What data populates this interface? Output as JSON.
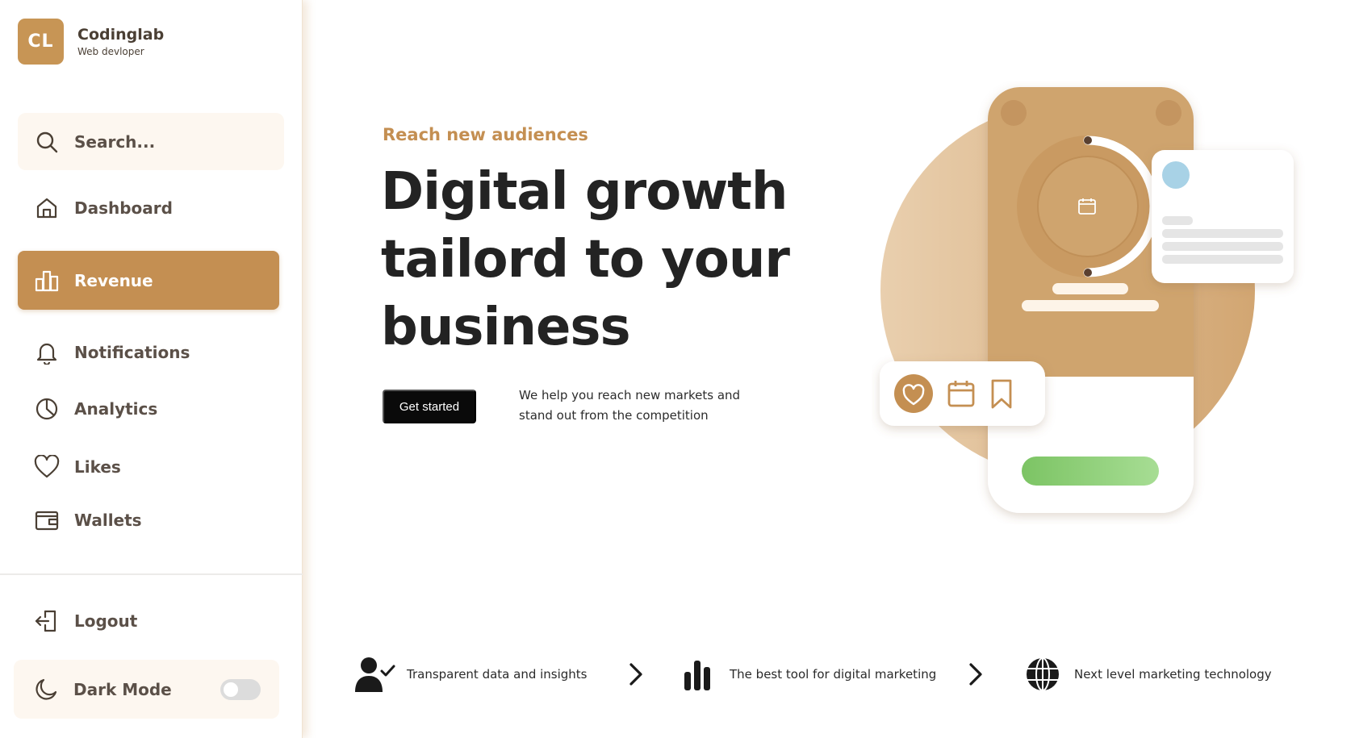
{
  "brand": {
    "initials": "CL",
    "name": "Codinglab",
    "role": "Web devloper"
  },
  "sidebar": {
    "search_label": "Search...",
    "items": [
      {
        "label": "Dashboard",
        "icon": "home-icon"
      },
      {
        "label": "Revenue",
        "icon": "bar-chart-icon",
        "active": true
      },
      {
        "label": "Notifications",
        "icon": "bell-icon"
      },
      {
        "label": "Analytics",
        "icon": "pie-chart-icon"
      },
      {
        "label": "Likes",
        "icon": "heart-icon"
      },
      {
        "label": "Wallets",
        "icon": "wallet-icon"
      }
    ],
    "logout_label": "Logout",
    "dark_mode_label": "Dark Mode",
    "dark_mode_on": false
  },
  "hero": {
    "eyebrow": "Reach new audiences",
    "headline": "Digital growth tailord to your business",
    "cta_label": "Get started",
    "tagline": "We help you reach new markets and stand out from the competition"
  },
  "features": [
    {
      "text": "Transparent data and insights",
      "icon": "user-check-icon"
    },
    {
      "text": "The best tool for digital marketing",
      "icon": "bar-chart-icon"
    },
    {
      "text": "Next level marketing technology",
      "icon": "globe-icon"
    }
  ],
  "colors": {
    "accent": "#c48f52",
    "text": "#232323",
    "sidebar_text": "#5b5048"
  }
}
